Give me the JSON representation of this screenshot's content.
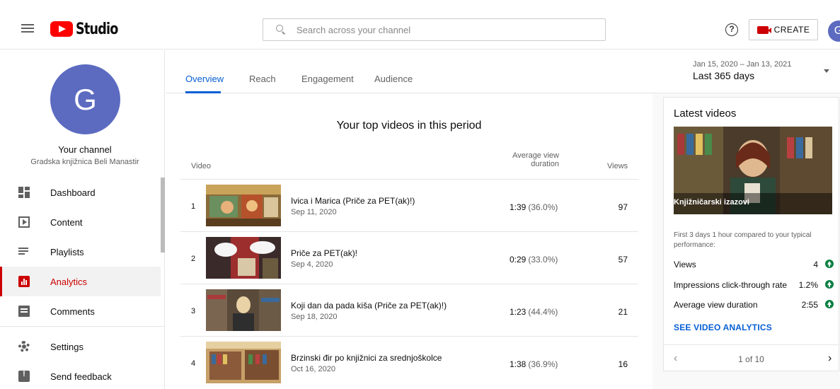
{
  "header": {
    "logo_text": "Studio",
    "search_placeholder": "Search across your channel",
    "help_icon": "?",
    "create_label": "CREATE",
    "avatar_letter": "G"
  },
  "sidebar": {
    "avatar_letter": "G",
    "your_channel": "Your channel",
    "channel_name": "Gradska knjižnica Beli Manastir",
    "items": [
      {
        "label": "Dashboard",
        "icon": "dashboard-icon"
      },
      {
        "label": "Content",
        "icon": "content-icon"
      },
      {
        "label": "Playlists",
        "icon": "playlists-icon"
      },
      {
        "label": "Analytics",
        "icon": "analytics-icon",
        "active": true
      },
      {
        "label": "Comments",
        "icon": "comments-icon"
      },
      {
        "label": "Settings",
        "icon": "settings-icon"
      },
      {
        "label": "Send feedback",
        "icon": "feedback-icon"
      }
    ]
  },
  "tabs": [
    {
      "label": "Overview",
      "active": true
    },
    {
      "label": "Reach"
    },
    {
      "label": "Engagement"
    },
    {
      "label": "Audience"
    }
  ],
  "date_range": {
    "range": "Jan 15, 2020 – Jan 13, 2021",
    "label": "Last 365 days"
  },
  "top_videos": {
    "title": "Your top videos in this period",
    "columns": {
      "video": "Video",
      "avg_view_line1": "Average view",
      "avg_view_line2": "duration",
      "views": "Views"
    },
    "rows": [
      {
        "num": "1",
        "title": "Ivica i Marica (Priče za PET(ak)!)",
        "date": "Sep 11, 2020",
        "duration": "1:39",
        "pct": "(36.0%)",
        "views": "97"
      },
      {
        "num": "2",
        "title": "Priče za PET(ak)!",
        "date": "Sep 4, 2020",
        "duration": "0:29",
        "pct": "(33.0%)",
        "views": "57"
      },
      {
        "num": "3",
        "title": "Koji dan da pada kiša (Priče za PET(ak)!)",
        "date": "Sep 18, 2020",
        "duration": "1:23",
        "pct": "(44.4%)",
        "views": "21"
      },
      {
        "num": "4",
        "title": "Brzinski đir po knjižnici za srednjoškolce",
        "date": "Oct 16, 2020",
        "duration": "1:38",
        "pct": "(36.9%)",
        "views": "16"
      }
    ]
  },
  "latest": {
    "title": "Latest videos",
    "video_title": "Knjižničarski izazovi",
    "performance_text": "First 3 days 1 hour compared to your typical performance:",
    "metrics": [
      {
        "label": "Views",
        "value": "4"
      },
      {
        "label": "Impressions click-through rate",
        "value": "1.2%"
      },
      {
        "label": "Average view duration",
        "value": "2:55"
      }
    ],
    "link": "SEE VIDEO ANALYTICS",
    "pager": "1 of 10"
  },
  "colors": {
    "accent_blue": "#065fd4",
    "brand_red": "#ff0000",
    "active_red": "#cc0000",
    "up_green": "#0a8043",
    "avatar": "#5c6bc0"
  }
}
